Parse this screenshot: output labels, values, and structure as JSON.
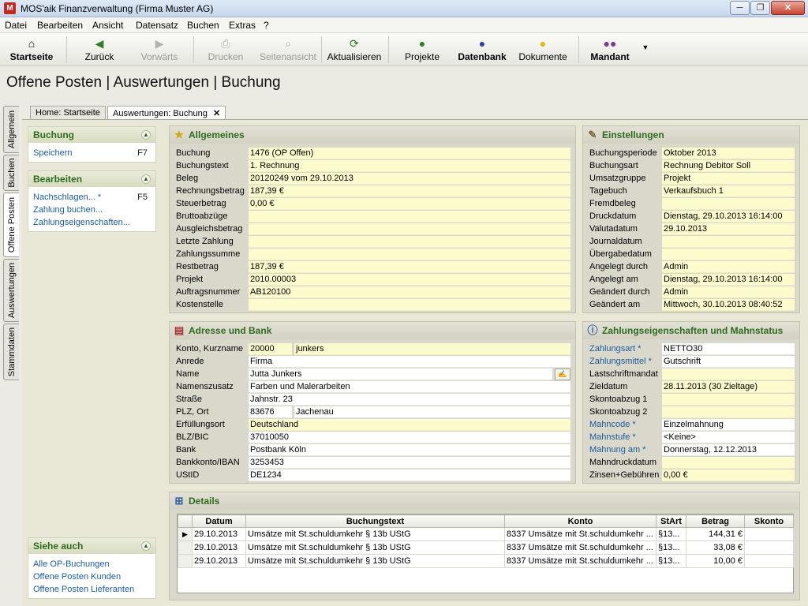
{
  "window": {
    "title": "MOS'aik Finanzverwaltung (Firma Muster AG)",
    "app_icon_letter": "M"
  },
  "menu": [
    "Datei",
    "Bearbeiten",
    "Ansicht",
    "Datensatz",
    "Buchen",
    "Extras",
    "?"
  ],
  "toolbar": {
    "startseite": "Startseite",
    "zurueck": "Zurück",
    "vorwaerts": "Vorwärts",
    "drucken": "Drucken",
    "seitenansicht": "Seitenansicht",
    "aktualisieren": "Aktualisieren",
    "projekte": "Projekte",
    "datenbank": "Datenbank",
    "dokumente": "Dokumente",
    "mandant": "Mandant"
  },
  "page_title": "Offene Posten | Auswertungen | Buchung",
  "vertical_tabs": [
    "Allgemein",
    "Buchen",
    "Offene Posten",
    "Auswertungen",
    "Stammdaten"
  ],
  "doc_tabs": {
    "home": "Home: Startseite",
    "active": "Auswertungen: Buchung"
  },
  "sidebar": {
    "buchung": {
      "title": "Buchung",
      "items": [
        {
          "label": "Speichern",
          "key": "F7"
        }
      ]
    },
    "bearbeiten": {
      "title": "Bearbeiten",
      "items": [
        {
          "label": "Nachschlagen... *",
          "key": "F5"
        },
        {
          "label": "Zahlung buchen...",
          "key": ""
        },
        {
          "label": "Zahlungseigenschaften...",
          "key": ""
        }
      ]
    },
    "siehe_auch": {
      "title": "Siehe auch",
      "items": [
        {
          "label": "Alle OP-Buchungen"
        },
        {
          "label": "Offene Posten Kunden"
        },
        {
          "label": "Offene Posten Lieferanten"
        }
      ]
    }
  },
  "allgemeines": {
    "title": "Allgemeines",
    "fields": [
      {
        "label": "Buchung",
        "value": "1476 (OP Offen)"
      },
      {
        "label": "Buchungstext",
        "value": "1. Rechnung"
      },
      {
        "label": "Beleg",
        "value": "20120249 vom 29.10.2013"
      },
      {
        "label": "Rechnungsbetrag",
        "value": "187,39 €"
      },
      {
        "label": "Steuerbetrag",
        "value": "0,00 €"
      },
      {
        "label": "Bruttoabzüge",
        "value": ""
      },
      {
        "label": "Ausgleichsbetrag",
        "value": ""
      },
      {
        "label": "Letzte Zahlung",
        "value": ""
      },
      {
        "label": "Zahlungssumme",
        "value": ""
      },
      {
        "label": "Restbetrag",
        "value": "187,39 €"
      },
      {
        "label": "Projekt",
        "value": "2010.00003"
      },
      {
        "label": "Auftragsnummer",
        "value": "AB120100"
      },
      {
        "label": "Kostenstelle",
        "value": ""
      }
    ]
  },
  "einstellungen": {
    "title": "Einstellungen",
    "fields": [
      {
        "label": "Buchungsperiode",
        "value": "Oktober 2013"
      },
      {
        "label": "Buchungsart",
        "value": "Rechnung Debitor Soll"
      },
      {
        "label": "Umsatzgruppe",
        "value": "Projekt"
      },
      {
        "label": "Tagebuch",
        "value": "Verkaufsbuch 1"
      },
      {
        "label": "Fremdbeleg",
        "value": ""
      },
      {
        "label": "Druckdatum",
        "value": "Dienstag, 29.10.2013 16:14:00"
      },
      {
        "label": "Valutadatum",
        "value": "29.10.2013"
      },
      {
        "label": "Journaldatum",
        "value": ""
      },
      {
        "label": "Übergabedatum",
        "value": ""
      },
      {
        "label": "Angelegt durch",
        "value": "Admin"
      },
      {
        "label": "Angelegt am",
        "value": "Dienstag, 29.10.2013 16:14:00"
      },
      {
        "label": "Geändert durch",
        "value": "Admin"
      },
      {
        "label": "Geändert am",
        "value": "Mittwoch, 30.10.2013 08:40:52"
      }
    ]
  },
  "adresse": {
    "title": "Adresse und Bank",
    "konto_label": "Konto, Kurzname",
    "konto": "20000",
    "kurzname": "junkers",
    "anrede_label": "Anrede",
    "anrede": "Firma",
    "name_label": "Name",
    "name": "Jutta Junkers",
    "namenszusatz_label": "Namenszusatz",
    "namenszusatz": "Farben und Malerarbeiten",
    "strasse_label": "Straße",
    "strasse": "Jahnstr. 23",
    "plz_label": "PLZ, Ort",
    "plz": "83676",
    "ort": "Jachenau",
    "erfuellungsort_label": "Erfüllungsort",
    "erfuellungsort": "Deutschland",
    "blz_label": "BLZ/BIC",
    "blz": "37010050",
    "bank_label": "Bank",
    "bank": "Postbank Köln",
    "iban_label": "Bankkonto/IBAN",
    "iban": "3253453",
    "ustid_label": "UStID",
    "ustid": "DE1234"
  },
  "zahlung": {
    "title": "Zahlungseigenschaften und Mahnstatus",
    "fields": [
      {
        "label": "Zahlungsart *",
        "value": "NETTO30",
        "link": true,
        "white": true
      },
      {
        "label": "Zahlungsmittel *",
        "value": "Gutschrift",
        "link": true,
        "white": true
      },
      {
        "label": "Lastschriftmandat",
        "value": "",
        "link": false,
        "white": false
      },
      {
        "label": "Zieldatum",
        "value": "28.11.2013 (30 Zieltage)",
        "link": false,
        "white": false
      },
      {
        "label": "Skontoabzug 1",
        "value": "",
        "link": false,
        "white": false
      },
      {
        "label": "Skontoabzug 2",
        "value": "",
        "link": false,
        "white": false
      },
      {
        "label": "Mahncode *",
        "value": "Einzelmahnung",
        "link": true,
        "white": true
      },
      {
        "label": "Mahnstufe *",
        "value": "<Keine>",
        "link": true,
        "white": true
      },
      {
        "label": "Mahnung am *",
        "value": "Donnerstag, 12.12.2013",
        "link": true,
        "white": true
      },
      {
        "label": "Mahndruckdatum",
        "value": "",
        "link": false,
        "white": false
      },
      {
        "label": "Zinsen+Gebühren",
        "value": "0,00 €",
        "link": false,
        "white": false
      }
    ]
  },
  "details": {
    "title": "Details",
    "columns": [
      "Datum",
      "Buchungstext",
      "Konto",
      "StArt",
      "Betrag",
      "Skonto"
    ],
    "rows": [
      {
        "selected": true,
        "cells": [
          "29.10.2013",
          "Umsätze mit St.schuldumkehr § 13b UStG",
          "8337 Umsätze mit St.schuldumkehr ...",
          "§13...",
          "144,31 €",
          ""
        ]
      },
      {
        "selected": false,
        "cells": [
          "29.10.2013",
          "Umsätze mit St.schuldumkehr § 13b UStG",
          "8337 Umsätze mit St.schuldumkehr ...",
          "§13...",
          "33,08 €",
          ""
        ]
      },
      {
        "selected": false,
        "cells": [
          "29.10.2013",
          "Umsätze mit St.schuldumkehr § 13b UStG",
          "8337 Umsätze mit St.schuldumkehr ...",
          "§13...",
          "10,00 €",
          ""
        ]
      }
    ]
  },
  "colors": {
    "accent_green": "#2e6b1f",
    "link_blue": "#1d5b9e",
    "field_yellow": "#fcfbcd",
    "panel_bg": "#d9d8cb"
  }
}
